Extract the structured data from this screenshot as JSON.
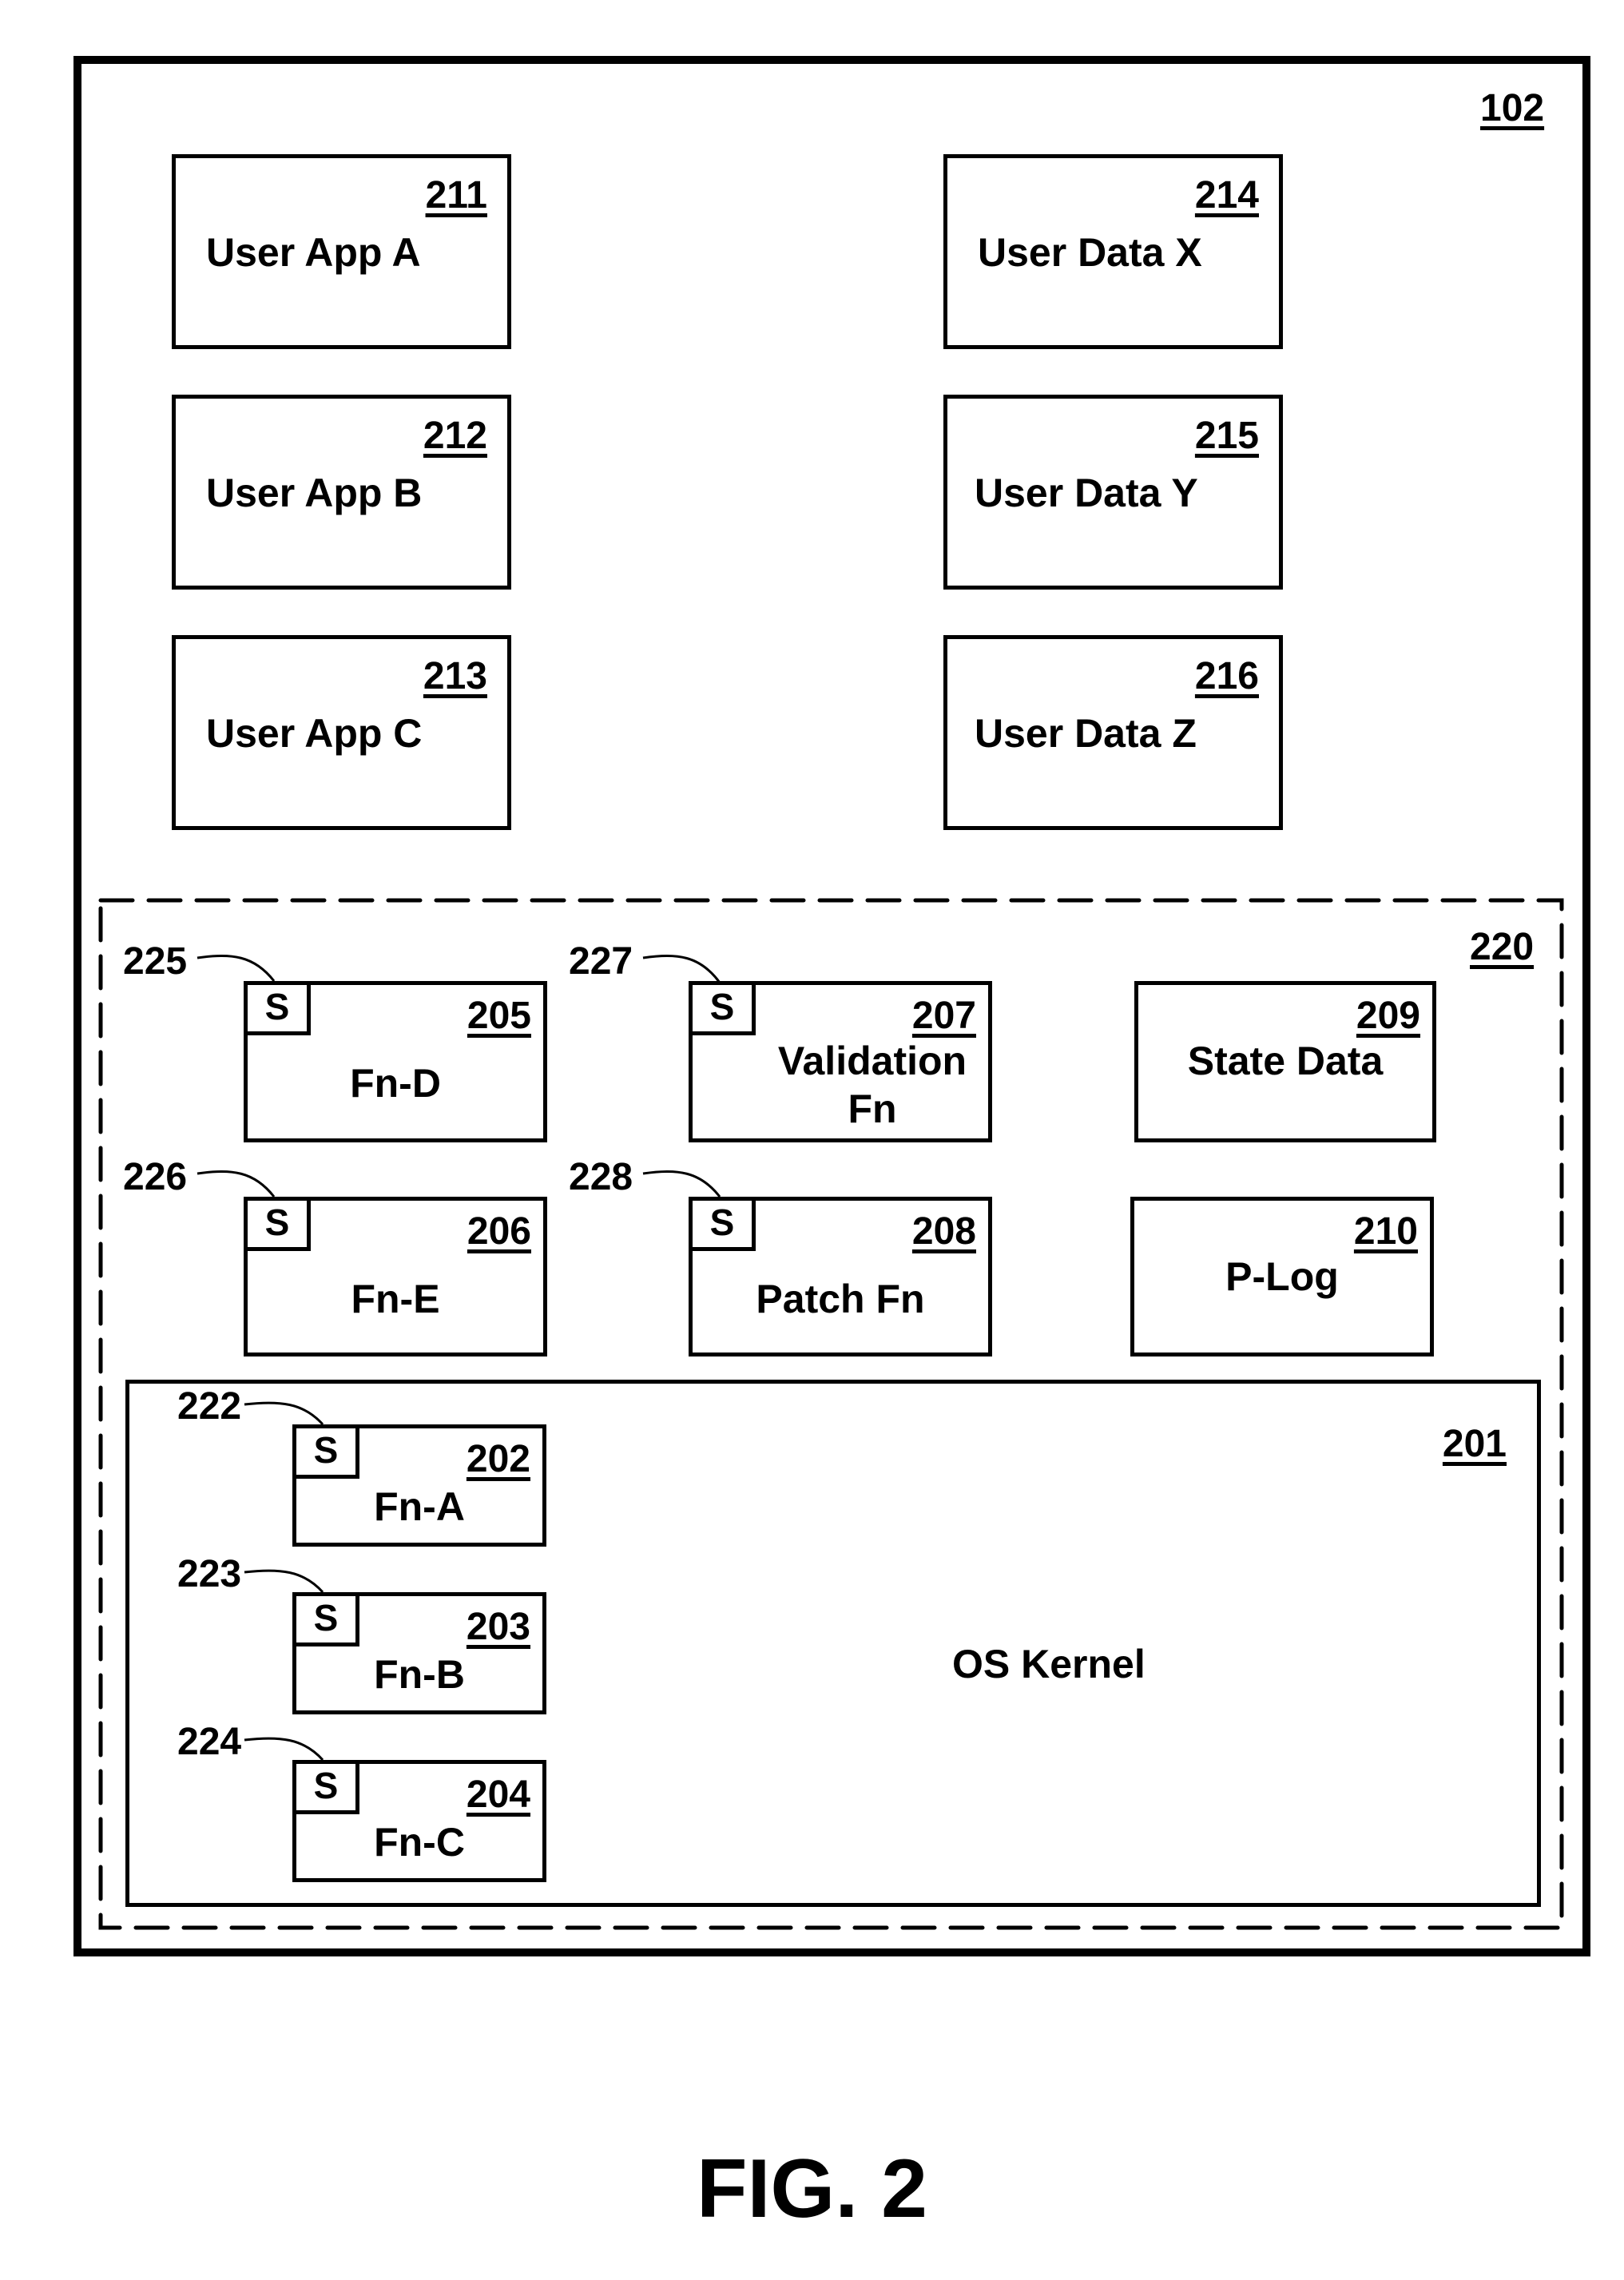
{
  "figure_label": "FIG. 2",
  "device": {
    "ref": "102"
  },
  "user_apps": [
    {
      "ref": "211",
      "label": "User App A"
    },
    {
      "ref": "212",
      "label": "User App B"
    },
    {
      "ref": "213",
      "label": "User App C"
    }
  ],
  "user_data": [
    {
      "ref": "214",
      "label": "User Data X"
    },
    {
      "ref": "215",
      "label": "User Data Y"
    },
    {
      "ref": "216",
      "label": "User Data Z"
    }
  ],
  "protected_region": {
    "ref": "220"
  },
  "functions": {
    "fn_d": {
      "ref": "205",
      "label": "Fn-D",
      "stub": "S",
      "stub_ref": "225"
    },
    "fn_e": {
      "ref": "206",
      "label": "Fn-E",
      "stub": "S",
      "stub_ref": "226"
    },
    "validation_fn": {
      "ref": "207",
      "label_line1": "Validation",
      "label_line2": "Fn",
      "stub": "S",
      "stub_ref": "227"
    },
    "patch_fn": {
      "ref": "208",
      "label": "Patch Fn",
      "stub": "S",
      "stub_ref": "228"
    },
    "state_data": {
      "ref": "209",
      "label": "State Data"
    },
    "p_log": {
      "ref": "210",
      "label": "P-Log"
    }
  },
  "kernel": {
    "ref": "201",
    "label": "OS Kernel",
    "functions": [
      {
        "ref": "202",
        "label": "Fn-A",
        "stub": "S",
        "stub_ref": "222"
      },
      {
        "ref": "203",
        "label": "Fn-B",
        "stub": "S",
        "stub_ref": "223"
      },
      {
        "ref": "204",
        "label": "Fn-C",
        "stub": "S",
        "stub_ref": "224"
      }
    ]
  }
}
